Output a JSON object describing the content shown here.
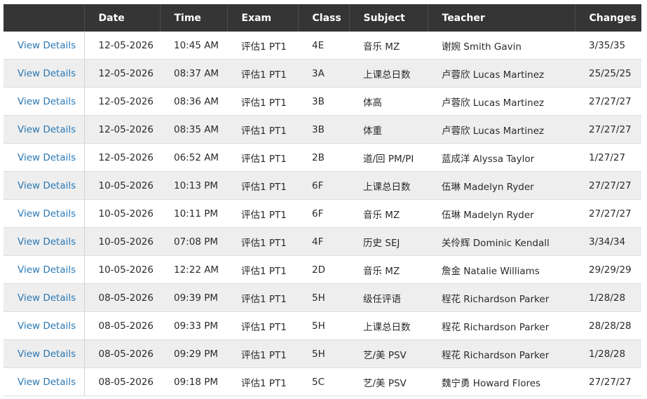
{
  "table": {
    "headers": [
      "",
      "Date",
      "Time",
      "Exam",
      "Class",
      "Subject",
      "Teacher",
      "Changes"
    ],
    "link_label": "View Details",
    "rows": [
      {
        "date": "12-05-2026",
        "time": "10:45 AM",
        "exam": "评估1 PT1",
        "class": "4E",
        "subject": "音乐 MZ",
        "teacher": "谢婉 Smith Gavin",
        "changes": "3/35/35"
      },
      {
        "date": "12-05-2026",
        "time": "08:37 AM",
        "exam": "评估1 PT1",
        "class": "3A",
        "subject": "上课总日数",
        "teacher": "卢蓉欣 Lucas Martinez",
        "changes": "25/25/25"
      },
      {
        "date": "12-05-2026",
        "time": "08:36 AM",
        "exam": "评估1 PT1",
        "class": "3B",
        "subject": "体高",
        "teacher": "卢蓉欣 Lucas Martinez",
        "changes": "27/27/27"
      },
      {
        "date": "12-05-2026",
        "time": "08:35 AM",
        "exam": "评估1 PT1",
        "class": "3B",
        "subject": "体重",
        "teacher": "卢蓉欣 Lucas Martinez",
        "changes": "27/27/27"
      },
      {
        "date": "12-05-2026",
        "time": "06:52 AM",
        "exam": "评估1 PT1",
        "class": "2B",
        "subject": "道/回 PM/PI",
        "teacher": "蓝成洋 Alyssa Taylor",
        "changes": "1/27/27"
      },
      {
        "date": "10-05-2026",
        "time": "10:13 PM",
        "exam": "评估1 PT1",
        "class": "6F",
        "subject": "上课总日数",
        "teacher": "伍琳 Madelyn Ryder",
        "changes": "27/27/27"
      },
      {
        "date": "10-05-2026",
        "time": "10:11 PM",
        "exam": "评估1 PT1",
        "class": "6F",
        "subject": "音乐 MZ",
        "teacher": "伍琳 Madelyn Ryder",
        "changes": "27/27/27"
      },
      {
        "date": "10-05-2026",
        "time": "07:08 PM",
        "exam": "评估1 PT1",
        "class": "4F",
        "subject": "历史 SEJ",
        "teacher": "关伶辉 Dominic Kendall",
        "changes": "3/34/34"
      },
      {
        "date": "10-05-2026",
        "time": "12:22 AM",
        "exam": "评估1 PT1",
        "class": "2D",
        "subject": "音乐 MZ",
        "teacher": "詹金 Natalie Williams",
        "changes": "29/29/29"
      },
      {
        "date": "08-05-2026",
        "time": "09:39 PM",
        "exam": "评估1 PT1",
        "class": "5H",
        "subject": "级任评语",
        "teacher": "程花 Richardson Parker",
        "changes": "1/28/28"
      },
      {
        "date": "08-05-2026",
        "time": "09:33 PM",
        "exam": "评估1 PT1",
        "class": "5H",
        "subject": "上课总日数",
        "teacher": "程花 Richardson Parker",
        "changes": "28/28/28"
      },
      {
        "date": "08-05-2026",
        "time": "09:29 PM",
        "exam": "评估1 PT1",
        "class": "5H",
        "subject": "艺/美 PSV",
        "teacher": "程花 Richardson Parker",
        "changes": "1/28/28"
      },
      {
        "date": "08-05-2026",
        "time": "09:18 PM",
        "exam": "评估1 PT1",
        "class": "5C",
        "subject": "艺/美 PSV",
        "teacher": "魏宁勇 Howard Flores",
        "changes": "27/27/27"
      }
    ]
  },
  "colors": {
    "header_bg": "#353535",
    "link": "#2a78b4",
    "row_alt_bg": "#eeeeee"
  }
}
